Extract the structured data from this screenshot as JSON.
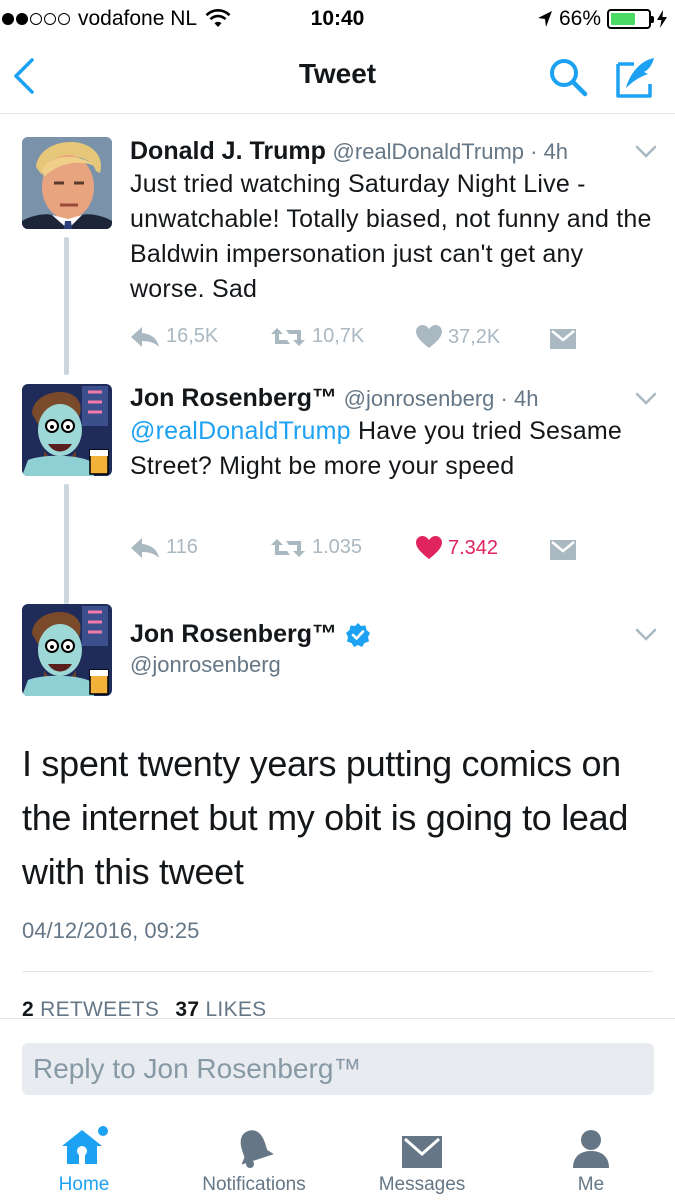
{
  "status_bar": {
    "carrier": "vodafone NL",
    "time": "10:40",
    "battery": "66%",
    "battery_level": 0.66,
    "signal_bars_filled": 2,
    "signal_bars_total": 5
  },
  "nav": {
    "title": "Tweet",
    "back_icon": "chevron-left-icon",
    "search_icon": "search-icon",
    "compose_icon": "compose-icon"
  },
  "tweets": [
    {
      "name": "Donald J. Trump",
      "handle": "@realDonaldTrump",
      "age": " · 4h",
      "text": "Just tried watching Saturday Night Live - unwatchable! Totally biased, not funny and the Baldwin impersonation just can't get any worse. Sad",
      "replies": "16,5K",
      "retweets": "10,7K",
      "likes": "37,2K",
      "liked": false
    },
    {
      "name": "Jon Rosenberg™",
      "handle": "@jonrosenberg",
      "age": " · 4h",
      "mention": "@realDonaldTrump",
      "text": " Have you tried Sesame Street? Might be more your speed",
      "replies": "116",
      "retweets": "1.035",
      "likes": "7.342",
      "liked": true
    }
  ],
  "main_tweet": {
    "name": "Jon Rosenberg™",
    "handle": "@jonrosenberg",
    "verified": true,
    "text": "I spent twenty years putting comics on the internet but my obit is going to lead with this tweet",
    "timestamp": "04/12/2016, 09:25",
    "retweets_count": "2",
    "retweets_label": "RETWEETS",
    "likes_count": "37",
    "likes_label": "LIKES"
  },
  "reply": {
    "placeholder": "Reply to Jon Rosenberg™"
  },
  "tabs": [
    {
      "label": "Home",
      "icon": "home-icon",
      "active": true
    },
    {
      "label": "Notifications",
      "icon": "bell-icon",
      "active": false
    },
    {
      "label": "Messages",
      "icon": "envelope-icon",
      "active": false
    },
    {
      "label": "Me",
      "icon": "person-icon",
      "active": false
    }
  ],
  "colors": {
    "accent": "#1da1f2",
    "like": "#e0245e",
    "muted": "#657786",
    "action_gray": "#aab8c2",
    "battery_green": "#4cd964"
  }
}
